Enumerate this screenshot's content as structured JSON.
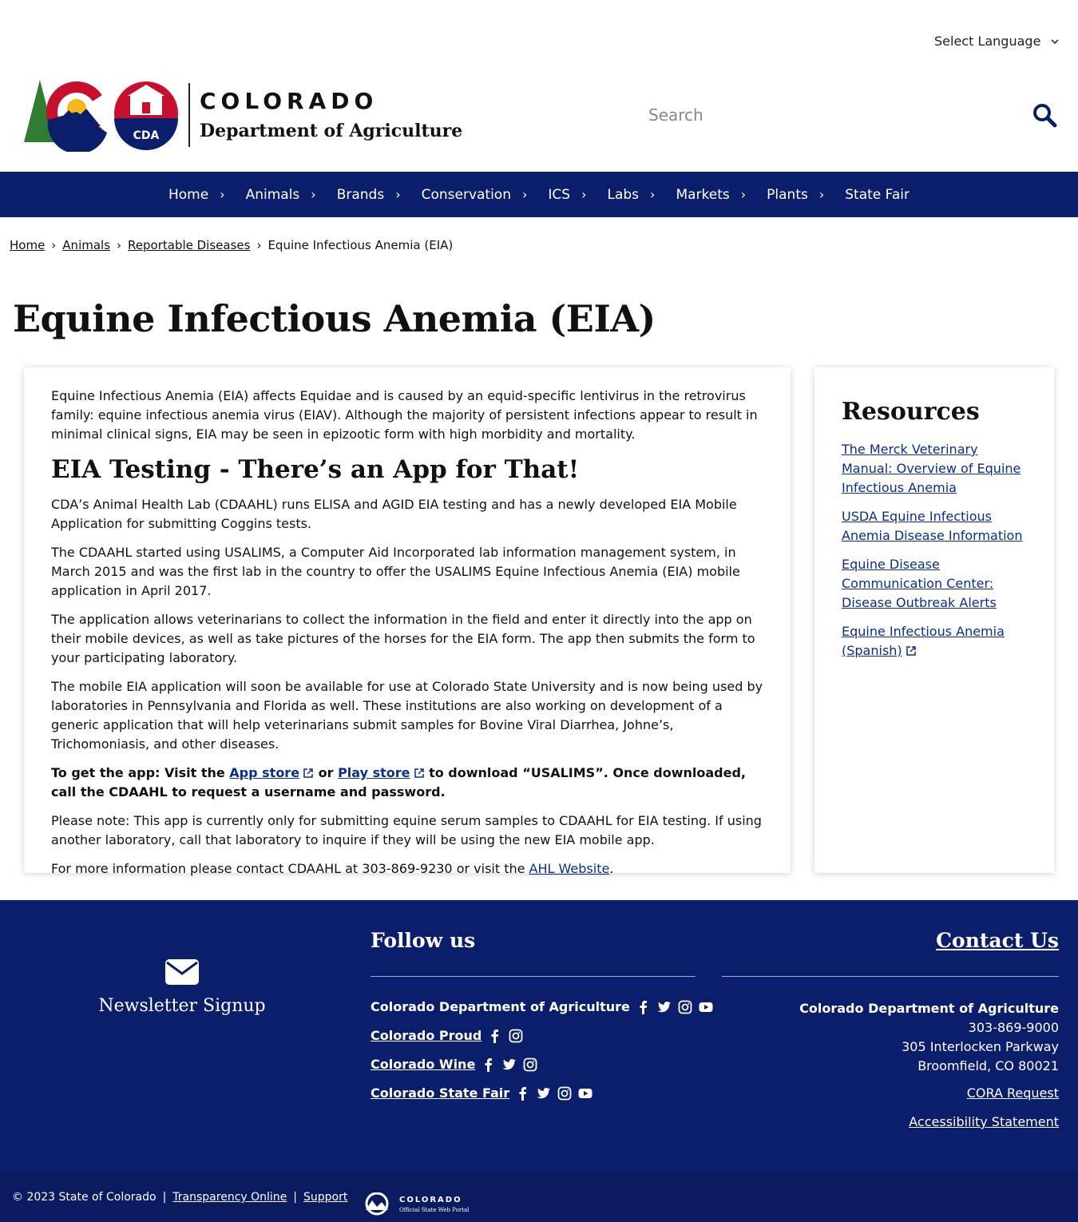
{
  "language": {
    "label": "Select Language"
  },
  "header": {
    "brand_title": "COLORADO",
    "brand_subtitle": "Department of Agriculture",
    "logo_badge": "CDA",
    "search_placeholder": "Search"
  },
  "nav": {
    "items": [
      {
        "label": "Home"
      },
      {
        "label": "Animals"
      },
      {
        "label": "Brands"
      },
      {
        "label": "Conservation"
      },
      {
        "label": "ICS"
      },
      {
        "label": "Labs"
      },
      {
        "label": "Markets"
      },
      {
        "label": "Plants"
      },
      {
        "label": "State Fair"
      }
    ]
  },
  "breadcrumb": {
    "items": [
      "Home",
      "Animals",
      "Reportable Diseases"
    ],
    "current": "Equine Infectious Anemia (EIA)"
  },
  "page": {
    "title": "Equine Infectious Anemia (EIA)",
    "intro": "Equine Infectious Anemia (EIA) affects Equidae and is caused by an equid-specific lentivirus in the retrovirus family: equine infectious anemia virus (EIAV). Although the majority of persistent infections appear to result in minimal clinical signs, EIA may be seen in epizootic form with high morbidity and mortality.",
    "heading": "EIA Testing - There’s an App for That!",
    "p1": "CDA’s Animal Health Lab (CDAAHL) runs ELISA and AGID EIA testing and has a newly developed EIA Mobile Application for submitting Coggins tests.",
    "p2": "The CDAAHL started using USALIMS, a Computer Aid Incorporated lab information management system, in March 2015 and was the first lab in the country to offer the USALIMS Equine Infectious Anemia (EIA) mobile application in April 2017.",
    "p3": "The application allows veterinarians to collect the information in the field and enter it directly into the app on their mobile devices, as well as take pictures of the horses for the EIA form. The app then submits the form to your participating laboratory.",
    "p4": "The mobile EIA application will soon be available for use at Colorado State University and is now being used by laboratories in Pennsylvania and Florida as well. These institutions are also working on development of a generic application that will help veterinarians submit samples for Bovine Viral Diarrhea, Johne’s, Trichomoniasis, and other diseases.",
    "get_app_prefix": "To get the app: Visit the ",
    "app_store": "App store",
    "or": " or ",
    "play_store": "Play store",
    "get_app_suffix": " to download “USALIMS”. Once downloaded, call the CDAAHL to request a username and password.",
    "note": "Please note: This app is currently only for submitting equine serum samples to CDAAHL for EIA testing. If using another laboratory, call that laboratory to inquire if they will be using the new EIA mobile app.",
    "contact_prefix": "For more information please contact CDAAHL at 303-869-9230 or visit the ",
    "ahl_link": "AHL Website",
    "contact_suffix": "."
  },
  "resources": {
    "title": "Resources",
    "links": [
      "The Merck Veterinary Manual: Overview of Equine Infectious Anemia",
      "USDA Equine Infectious Anemia Disease Information",
      "Equine Disease Communication Center: Disease Outbreak Alerts",
      "Equine Infectious Anemia (Spanish)"
    ]
  },
  "footer": {
    "newsletter": "Newsletter Signup",
    "follow_title": "Follow us",
    "contact_title": "Contact Us",
    "social": [
      "Colorado Department of Agriculture",
      "Colorado Proud",
      "Colorado Wine",
      "Colorado State Fair"
    ],
    "address": {
      "org": "Colorado Department of Agriculture",
      "phone": "303-869-9000",
      "street": "305 Interlocken Parkway",
      "city": "Broomfield, CO 80021"
    },
    "cora": "CORA Request",
    "accessibility": "Accessibility Statement"
  },
  "bottom": {
    "copyright": "© 2023 State of Colorado",
    "sep": "|",
    "transparency": "Transparency Online",
    "support": "Support",
    "portal_title": "COLORADO",
    "portal_sub": "Official State Web Portal"
  },
  "colors": {
    "navy": "#0b1e6b",
    "link": "#0b2e8a",
    "red": "#c8102e",
    "gold": "#f2b81c",
    "green": "#2e7d32"
  }
}
